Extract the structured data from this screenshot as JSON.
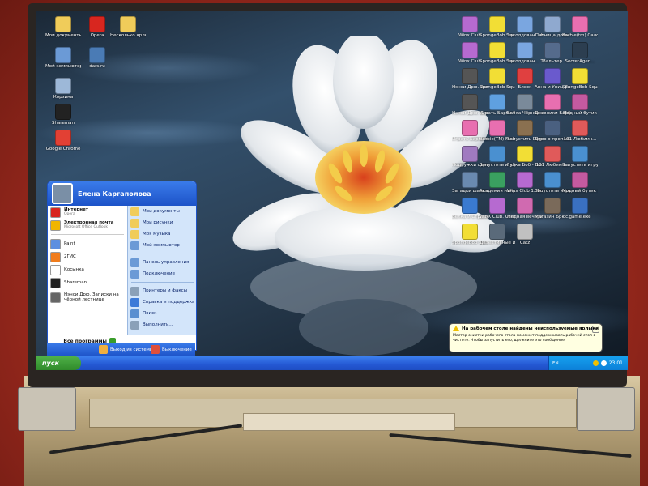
{
  "user_name": "Елена Каргаполова",
  "start_label": "пуск",
  "tray": {
    "lang": "EN",
    "clock": "23:01"
  },
  "balloon": {
    "title": "На рабочем столе найдены неиспользуемые ярлыки",
    "body": "Мастер очистки рабочего стола поможет поддерживать рабочий стол в чистоте. Чтобы запустить его, щелкните это сообщение."
  },
  "start_menu": {
    "left_items": [
      {
        "label": "Интернет",
        "sub": "Opera",
        "icon": "opera-icon",
        "color": "#d8261f"
      },
      {
        "label": "Электронная почта",
        "sub": "Microsoft Office Outlook",
        "icon": "outlook-icon",
        "color": "#f0b500"
      },
      {
        "label": "Paint",
        "sub": "",
        "icon": "paint-icon",
        "color": "#5d8fe0"
      },
      {
        "label": "2ГИС",
        "sub": "",
        "icon": "2gis-icon",
        "color": "#f07c1c"
      },
      {
        "label": "Косынка",
        "sub": "",
        "icon": "solitaire-icon",
        "color": "#ffffff"
      },
      {
        "label": "Shareman",
        "sub": "",
        "icon": "shareman-icon",
        "color": "#222222"
      },
      {
        "label": "Нэнси Дрю. Записки на чёрной лестнице",
        "sub": "",
        "icon": "nancy-drew-icon",
        "color": "#666666"
      }
    ],
    "all_programs": "Все программы",
    "right_items": [
      {
        "label": "Мои документы",
        "icon": "my-documents-icon",
        "color": "#f0cc5a"
      },
      {
        "label": "Мои рисунки",
        "icon": "my-pictures-icon",
        "color": "#f0cc5a"
      },
      {
        "label": "Моя музыка",
        "icon": "my-music-icon",
        "color": "#f0cc5a"
      },
      {
        "label": "Мой компьютер",
        "icon": "my-computer-icon",
        "color": "#6b9ad6"
      },
      {
        "label": "Панель управления",
        "icon": "control-panel-icon",
        "color": "#6b9ad6"
      },
      {
        "label": "Подключение",
        "icon": "connect-icon",
        "color": "#6b9ad6"
      },
      {
        "label": "Принтеры и факсы",
        "icon": "printer-icon",
        "color": "#8aa0b8"
      },
      {
        "label": "Справка и поддержка",
        "icon": "help-icon",
        "color": "#3c7ad8"
      },
      {
        "label": "Поиск",
        "icon": "search-icon",
        "color": "#5a8fd0"
      },
      {
        "label": "Выполнить...",
        "icon": "run-icon",
        "color": "#8aa0b8"
      }
    ],
    "logoff": "Выход из системы",
    "shutdown": "Выключение"
  },
  "desktop_icons": {
    "left": [
      {
        "label": "Мои документы",
        "icon": "folder-icon",
        "color": "#f0cc5a"
      },
      {
        "label": "Opera",
        "icon": "opera-icon",
        "color": "#d8261f"
      },
      {
        "label": "Несколько ярлыки",
        "icon": "folder-icon",
        "color": "#f0cc5a"
      },
      {
        "label": "Мой компьютер",
        "icon": "computer-icon",
        "color": "#6b9ad6"
      },
      {
        "label": "dars.ru",
        "icon": "web-icon",
        "color": "#4a7bb5"
      },
      {
        "label": "Корзина",
        "icon": "recycle-bin-icon",
        "color": "#9db8d8"
      },
      {
        "label": "Shareman",
        "icon": "shareman-icon",
        "color": "#222222"
      },
      {
        "label": "Google Chrome",
        "icon": "chrome-icon",
        "color": "#e24034"
      }
    ],
    "right": [
      {
        "label": "Winx Club",
        "icon": "winx-icon",
        "color": "#b66ad0"
      },
      {
        "label": "SpongeBob SquarePan...",
        "icon": "spongebob-icon",
        "color": "#f2de35"
      },
      {
        "label": "Заколдован... Катя и та...",
        "icon": "game-icon",
        "color": "#7aa6e0"
      },
      {
        "label": "Пятница домм",
        "icon": "game-icon",
        "color": "#8fa9cf"
      },
      {
        "label": "Barbie(tm) Салон и...",
        "icon": "barbie-icon",
        "color": "#e86fb0"
      },
      {
        "label": "Winx Club",
        "icon": "winx-icon",
        "color": "#b66ad0"
      },
      {
        "label": "SpongeBob SquarePan...",
        "icon": "spongebob-icon",
        "color": "#f2de35"
      },
      {
        "label": "Заколдован... Тайный дв...",
        "icon": "game-icon",
        "color": "#7aa6e0"
      },
      {
        "label": "Вальтер",
        "icon": "game-icon",
        "color": "#556b8c"
      },
      {
        "label": "SecretAgen...",
        "icon": "game-icon",
        "color": "#2c3e50"
      },
      {
        "label": "Нэнси Дрю. Записки на...",
        "icon": "nancy-drew-icon",
        "color": "#555555"
      },
      {
        "label": "SpongeBob SquarePan...",
        "icon": "spongebob-icon",
        "color": "#f2de35"
      },
      {
        "label": "Блеск",
        "icon": "game-icon",
        "color": "#e04040"
      },
      {
        "label": "Анна и Униц Тайны во...",
        "icon": "game-icon",
        "color": "#6a5acd"
      },
      {
        "label": "SpongeBob SquarePan...",
        "icon": "spongebob-icon",
        "color": "#f2de35"
      },
      {
        "label": "Нэнси Дрю. Сокровища...",
        "icon": "nancy-drew-icon",
        "color": "#555555"
      },
      {
        "label": "Играть Барби Морская...",
        "icon": "barbie-icon",
        "color": "#5fa0e0"
      },
      {
        "label": "Бабка Чёрные Ай...",
        "icon": "game-icon",
        "color": "#7a8a9a"
      },
      {
        "label": "Дневники Барби",
        "icon": "barbie-icon",
        "color": "#e86fb0"
      },
      {
        "label": "Модный бутик",
        "icon": "game-icon",
        "color": "#c45aa0"
      },
      {
        "label": "Играть Барби в роли Рап...",
        "icon": "barbie-icon",
        "color": "#e86fb0"
      },
      {
        "label": "Barbie(TM) Fashion ...",
        "icon": "barbie-icon",
        "color": "#e86fb0"
      },
      {
        "label": "Запустить Dogz",
        "icon": "game-icon",
        "color": "#8a7050"
      },
      {
        "label": "Дело о пропавш...",
        "icon": "game-icon",
        "color": "#4a6080"
      },
      {
        "label": "101 Любимч...",
        "icon": "game-icon",
        "color": "#e05a5a"
      },
      {
        "label": "Подружки одноклассн...",
        "icon": "game-icon",
        "color": "#a07ac0"
      },
      {
        "label": "Запустить игру (2)",
        "icon": "game-icon",
        "color": "#4a90d0"
      },
      {
        "label": "Губка Боб - Большое п...",
        "icon": "spongebob-icon",
        "color": "#f2de35"
      },
      {
        "label": "101 Любимч...",
        "icon": "game-icon",
        "color": "#e05a5a"
      },
      {
        "label": "Запустить игру (3)",
        "icon": "game-icon",
        "color": "#4a90d0"
      },
      {
        "label": "Загадки шарства она",
        "icon": "game-icon",
        "color": "#6a8ab0"
      },
      {
        "label": "Академия ниндзя",
        "icon": "game-icon",
        "color": "#3aa060"
      },
      {
        "label": "Winx Club 1. Фокус Света",
        "icon": "winx-icon",
        "color": "#b66ad0"
      },
      {
        "label": "Запустить игру",
        "icon": "game-icon",
        "color": "#4a90d0"
      },
      {
        "label": "Модный бутик 2",
        "icon": "game-icon",
        "color": "#c45aa0"
      },
      {
        "label": "Белка и Стрелк...",
        "icon": "game-icon",
        "color": "#3a7ad0"
      },
      {
        "label": "WinX Club. Секрет...",
        "icon": "winx-icon",
        "color": "#b66ad0"
      },
      {
        "label": "Модная вечеринка",
        "icon": "game-icon",
        "color": "#d06ab0"
      },
      {
        "label": "Магазин Брюс. Тай...",
        "icon": "game-icon",
        "color": "#7a6a5a"
      },
      {
        "label": "game.exe",
        "icon": "game-icon",
        "color": "#3a70c0"
      },
      {
        "label": "SpongeBob SquarePan...",
        "icon": "spongebob-icon",
        "color": "#f2de35"
      },
      {
        "label": "Детективные истории. Т...",
        "icon": "game-icon",
        "color": "#5a6a7a"
      },
      {
        "label": "Catz",
        "icon": "catz-icon",
        "color": "#c0c0c0"
      }
    ]
  },
  "photo_background": "#b53325"
}
